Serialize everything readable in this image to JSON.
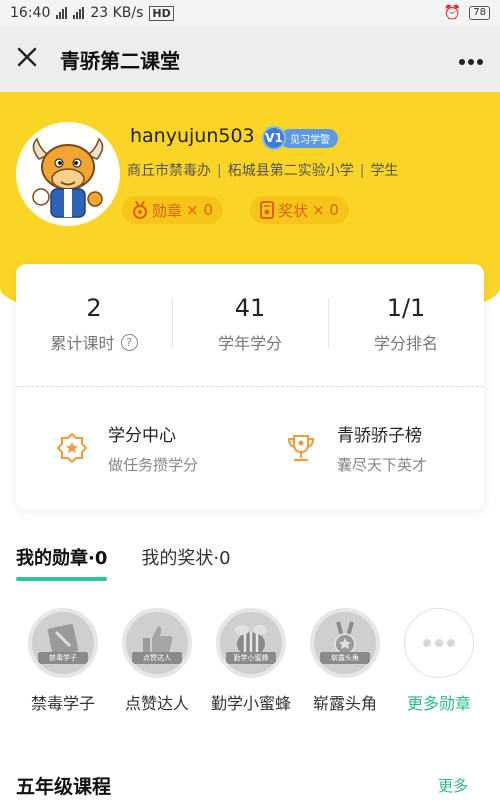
{
  "status": {
    "time": "16:40",
    "net": "4G",
    "speed": "23 KB/s",
    "hd": "HD",
    "battery": "78"
  },
  "nav": {
    "title": "青骄第二课堂"
  },
  "profile": {
    "username": "hanyujun503",
    "level": "V1",
    "level_title": "见习学警",
    "org": "商丘市禁毒办",
    "school": "柘城县第二实验小学",
    "role": "学生",
    "medal_label": "勋章",
    "medal_count": "× 0",
    "award_label": "奖状",
    "award_count": "× 0"
  },
  "stats": [
    {
      "value": "2",
      "label": "累计课时"
    },
    {
      "value": "41",
      "label": "学年学分"
    },
    {
      "value": "1/1",
      "label": "学分排名"
    }
  ],
  "links": [
    {
      "title": "学分中心",
      "subtitle": "做任务攒学分"
    },
    {
      "title": "青骄骄子榜",
      "subtitle": "囊尽天下英才"
    }
  ],
  "tabs": [
    {
      "label": "我的勋章·0"
    },
    {
      "label": "我的奖状·0"
    }
  ],
  "badges": [
    {
      "label": "禁毒学子",
      "ribbon": "禁毒学子"
    },
    {
      "label": "点赞达人",
      "ribbon": "点赞达人"
    },
    {
      "label": "勤学小蜜蜂",
      "ribbon": "勤学小蜜蜂"
    },
    {
      "label": "崭露头角",
      "ribbon": "崭露头角"
    }
  ],
  "more_badges": "更多勋章",
  "section": {
    "title": "五年级课程",
    "more": "更多"
  },
  "colors": {
    "brand_yellow": "#fbd525",
    "accent_green": "#2fc49e",
    "pill_orange": "#d9650d"
  }
}
